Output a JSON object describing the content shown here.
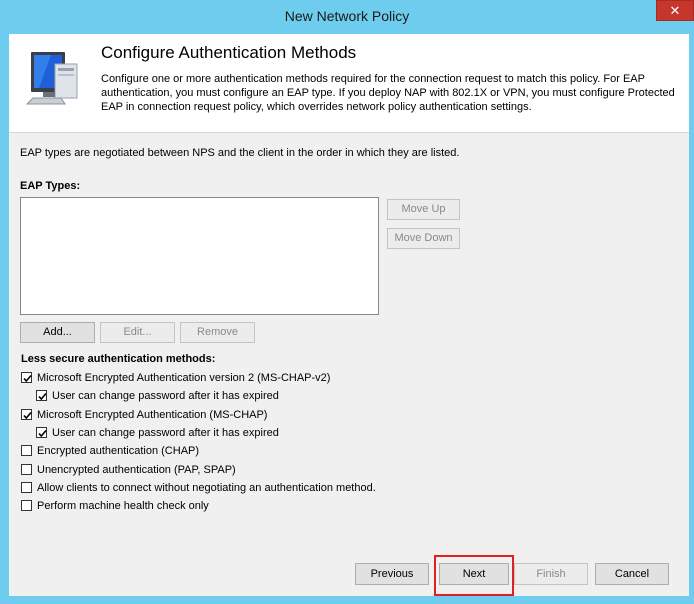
{
  "window": {
    "title": "New Network Policy",
    "close_symbol": "✕"
  },
  "header": {
    "title": "Configure Authentication Methods",
    "description": "Configure one or more authentication methods required for the connection request to match this policy. For EAP authentication, you must configure an EAP type. If you deploy NAP with 802.1X or VPN, you must configure Protected EAP in connection request policy, which overrides network policy authentication settings.",
    "icon": "monitor-icon"
  },
  "info_text": "EAP types are negotiated between NPS and the client in the order in which they are listed.",
  "eap": {
    "label": "EAP Types:",
    "items": [],
    "move_up": "Move Up",
    "move_down": "Move Down",
    "add": "Add...",
    "edit": "Edit...",
    "remove": "Remove"
  },
  "less_secure": {
    "label": "Less secure authentication methods:",
    "options": [
      {
        "label": "Microsoft Encrypted Authentication version 2 (MS-CHAP-v2)",
        "checked": true,
        "indent": 0
      },
      {
        "label": "User can change password after it has expired",
        "checked": true,
        "indent": 1
      },
      {
        "label": "Microsoft Encrypted Authentication (MS-CHAP)",
        "checked": true,
        "indent": 0
      },
      {
        "label": "User can change password after it has expired",
        "checked": true,
        "indent": 1
      },
      {
        "label": "Encrypted authentication (CHAP)",
        "checked": false,
        "indent": 0
      },
      {
        "label": "Unencrypted authentication (PAP, SPAP)",
        "checked": false,
        "indent": 0
      },
      {
        "label": "Allow clients to connect without negotiating an authentication method.",
        "checked": false,
        "indent": 0
      },
      {
        "label": "Perform machine health check only",
        "checked": false,
        "indent": 0
      }
    ]
  },
  "footer": {
    "previous": "Previous",
    "next": "Next",
    "finish": "Finish",
    "cancel": "Cancel"
  },
  "colors": {
    "frame": "#6ecdee",
    "highlight": "#e21f25",
    "close": "#c7362d"
  }
}
